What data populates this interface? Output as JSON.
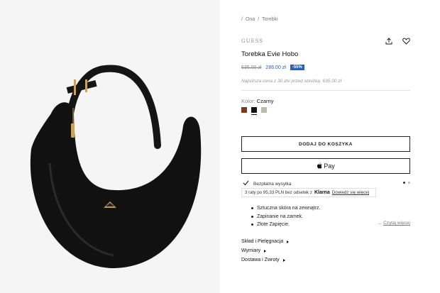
{
  "breadcrumb": {
    "prefix": "/",
    "items": [
      "Ona",
      "Torebki"
    ],
    "separator": "/"
  },
  "product": {
    "brand": "GUESS",
    "title": "Torebka Evie Hobo",
    "price_old": "635.00 zł",
    "price_new": "286.00 zł",
    "discount": "-55%",
    "lowest_price_note": "Najniższa cena z 30 dni przed obniżką: 635.00 zł",
    "color_label": "Kolor:",
    "color_value": "Czarny",
    "swatches": [
      {
        "name": "brown",
        "color": "#7a3a22"
      },
      {
        "name": "black",
        "color": "#111111",
        "selected": true
      },
      {
        "name": "beige",
        "color": "#c2b9ad"
      }
    ]
  },
  "actions": {
    "share_icon": "share-icon",
    "wishlist_icon": "heart-icon"
  },
  "buttons": {
    "add_to_cart": "DODAJ DO KOSZYKA",
    "apple_pay": "Pay",
    "apple_pay_icon": "apple-icon"
  },
  "shipping": {
    "text": "Bezpłatna wysyłka",
    "icon": "check-icon"
  },
  "klarna": {
    "text": "3 raty po 95,33 PLN bez odsetek z",
    "logo": "Klarna",
    "link": "Dowiedz się więcej"
  },
  "features": [
    "Sztuczna skóra na zewnątrz.",
    "Zapinanie na zamek.",
    "Złote Zapięcie."
  ],
  "read_more": {
    "prefix": "...",
    "label": "Czytaj więcej"
  },
  "accordion": [
    "Skład i Pielęgnacja",
    "Wymiary",
    "Dostawa i Zwroty"
  ],
  "colors": {
    "accent_blue": "#2b5fb8",
    "image_bg": "#f5f5f5",
    "bag": "#111111",
    "hardware_gold": "#c9a35b"
  }
}
